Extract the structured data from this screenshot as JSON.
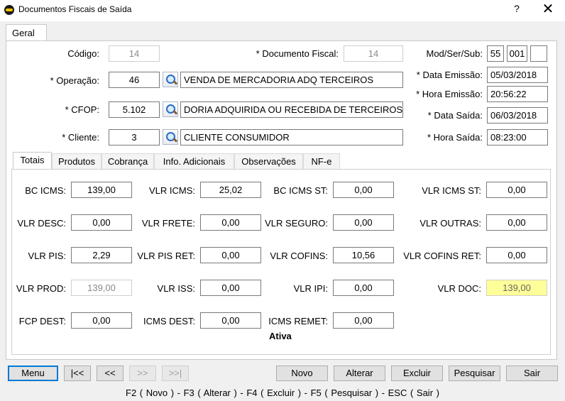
{
  "window": {
    "title": "Documentos Fiscais de Saída",
    "help": "?",
    "close": "✕"
  },
  "tabs": {
    "geral": "Geral"
  },
  "header": {
    "codigo": {
      "label": "Código:",
      "value": "14"
    },
    "documento_fiscal": {
      "label": "* Documento Fiscal:",
      "value": "14"
    },
    "mod_ser_sub": {
      "label": "Mod/Ser/Sub:",
      "mod": "55",
      "ser": "001",
      "sub": ""
    },
    "operacao": {
      "label": "* Operação:",
      "code": "46",
      "desc": "VENDA DE MERCADORIA ADQ TERCEIROS"
    },
    "data_emissao": {
      "label": "* Data Emissão:",
      "value": "05/03/2018"
    },
    "hora_emissao": {
      "label": "* Hora Emissão:",
      "value": "20:56:22"
    },
    "cfop": {
      "label": "* CFOP:",
      "code": "5.102",
      "desc": "DORIA ADQUIRIDA OU RECEBIDA DE TERCEIROS"
    },
    "data_saida": {
      "label": "* Data Saída:",
      "value": "06/03/2018"
    },
    "cliente": {
      "label": "* Cliente:",
      "code": "3",
      "desc": "CLIENTE CONSUMIDOR"
    },
    "hora_saida": {
      "label": "* Hora Saída:",
      "value": "08:23:00"
    }
  },
  "inner_tabs": [
    "Totais",
    "Produtos",
    "Cobrança",
    "Info. Adicionais",
    "Observações",
    "NF-e"
  ],
  "totais": {
    "bc_icms": {
      "label": "BC ICMS:",
      "value": "139,00"
    },
    "vlr_icms": {
      "label": "VLR ICMS:",
      "value": "25,02"
    },
    "bc_icms_st": {
      "label": "BC ICMS ST:",
      "value": "0,00"
    },
    "vlr_icms_st": {
      "label": "VLR ICMS ST:",
      "value": "0,00"
    },
    "vlr_desc": {
      "label": "VLR DESC:",
      "value": "0,00"
    },
    "vlr_frete": {
      "label": "VLR FRETE:",
      "value": "0,00"
    },
    "vlr_seguro": {
      "label": "VLR SEGURO:",
      "value": "0,00"
    },
    "vlr_outras": {
      "label": "VLR OUTRAS:",
      "value": "0,00"
    },
    "vlr_pis": {
      "label": "VLR PIS:",
      "value": "2,29"
    },
    "vlr_pis_ret": {
      "label": "VLR PIS RET:",
      "value": "0,00"
    },
    "vlr_cofins": {
      "label": "VLR COFINS:",
      "value": "10,56"
    },
    "vlr_cofins_ret": {
      "label": "VLR COFINS RET:",
      "value": "0,00"
    },
    "vlr_prod": {
      "label": "VLR PROD:",
      "value": "139,00"
    },
    "vlr_iss": {
      "label": "VLR ISS:",
      "value": "0,00"
    },
    "vlr_ipi": {
      "label": "VLR IPI:",
      "value": "0,00"
    },
    "vlr_doc": {
      "label": "VLR DOC:",
      "value": "139,00"
    },
    "fcp_dest": {
      "label": "FCP DEST:",
      "value": "0,00"
    },
    "icms_dest": {
      "label": "ICMS DEST:",
      "value": "0,00"
    },
    "icms_remet": {
      "label": "ICMS REMET:",
      "value": "0,00"
    },
    "status": "Ativa"
  },
  "buttons": {
    "menu": "Menu",
    "first": "|<<",
    "prev": "<<",
    "next": ">>",
    "last": ">>|",
    "novo": "Novo",
    "alterar": "Alterar",
    "excluir": "Excluir",
    "pesquisar": "Pesquisar",
    "sair": "Sair"
  },
  "shortcuts": "F2 ( Novo )  -  F3 ( Alterar )  -  F4 ( Excluir )  -  F5 ( Pesquisar )  -  ESC ( Sair )",
  "colors": {
    "vlr_doc_bg": "#ffff99",
    "default_button_border": "#0078d7"
  }
}
